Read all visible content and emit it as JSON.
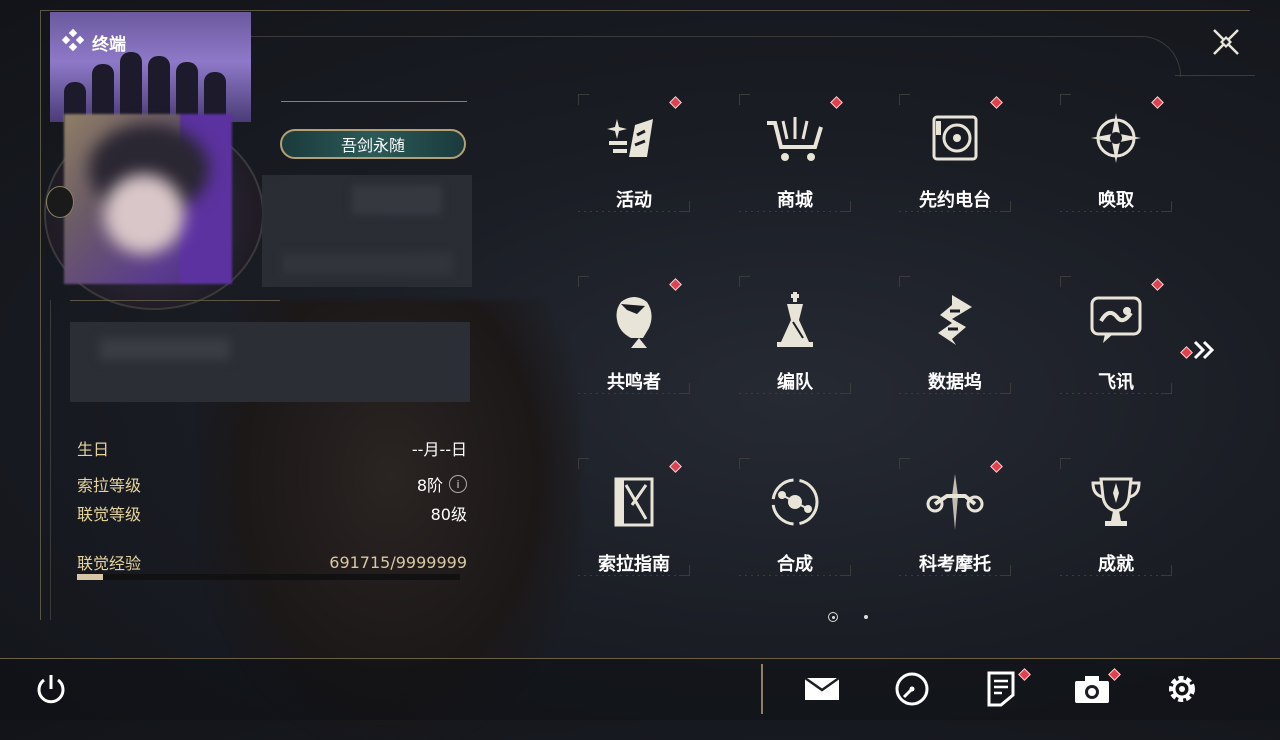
{
  "header": {
    "title": "终端",
    "title_icon": "diamond-cluster-icon",
    "close_icon": "close-x-icon"
  },
  "profile": {
    "title_badge": "吾剑永随",
    "birthday_label": "生日",
    "birthday_value": "--月--日",
    "sola_level_label": "索拉等级",
    "sola_level_value": "8阶",
    "union_level_label": "联觉等级",
    "union_level_value": "80级",
    "union_exp_label": "联觉经验",
    "union_exp_value": "691715/9999999",
    "union_exp_fraction": 0.069
  },
  "menu": {
    "items": [
      {
        "label": "活动",
        "icon": "sparkle-shard-icon",
        "badge": true
      },
      {
        "label": "商城",
        "icon": "shopping-cart-icon",
        "badge": true
      },
      {
        "label": "先约电台",
        "icon": "radio-speaker-icon",
        "badge": true
      },
      {
        "label": "唤取",
        "icon": "compass-star-icon",
        "badge": true
      },
      {
        "label": "共鸣者",
        "icon": "character-head-icon",
        "badge": true
      },
      {
        "label": "编队",
        "icon": "chess-pieces-icon",
        "badge": false
      },
      {
        "label": "数据坞",
        "icon": "data-dock-icon",
        "badge": false
      },
      {
        "label": "飞讯",
        "icon": "chat-bubble-icon",
        "badge": true
      },
      {
        "label": "索拉指南",
        "icon": "guide-book-icon",
        "badge": true
      },
      {
        "label": "合成",
        "icon": "synthesis-orbit-icon",
        "badge": false
      },
      {
        "label": "科考摩托",
        "icon": "motorbike-icon",
        "badge": true
      },
      {
        "label": "成就",
        "icon": "trophy-icon",
        "badge": false
      }
    ],
    "page_count": 2,
    "current_page": 1
  },
  "bottom_bar": {
    "icons": [
      "power-icon",
      "mail-icon",
      "clock-icon",
      "notes-icon",
      "camera-icon",
      "settings-gear-icon"
    ]
  },
  "colors": {
    "accent_gold": "#e6d39c",
    "badge_red": "#e0414e",
    "frame_line": "#5d5544"
  }
}
